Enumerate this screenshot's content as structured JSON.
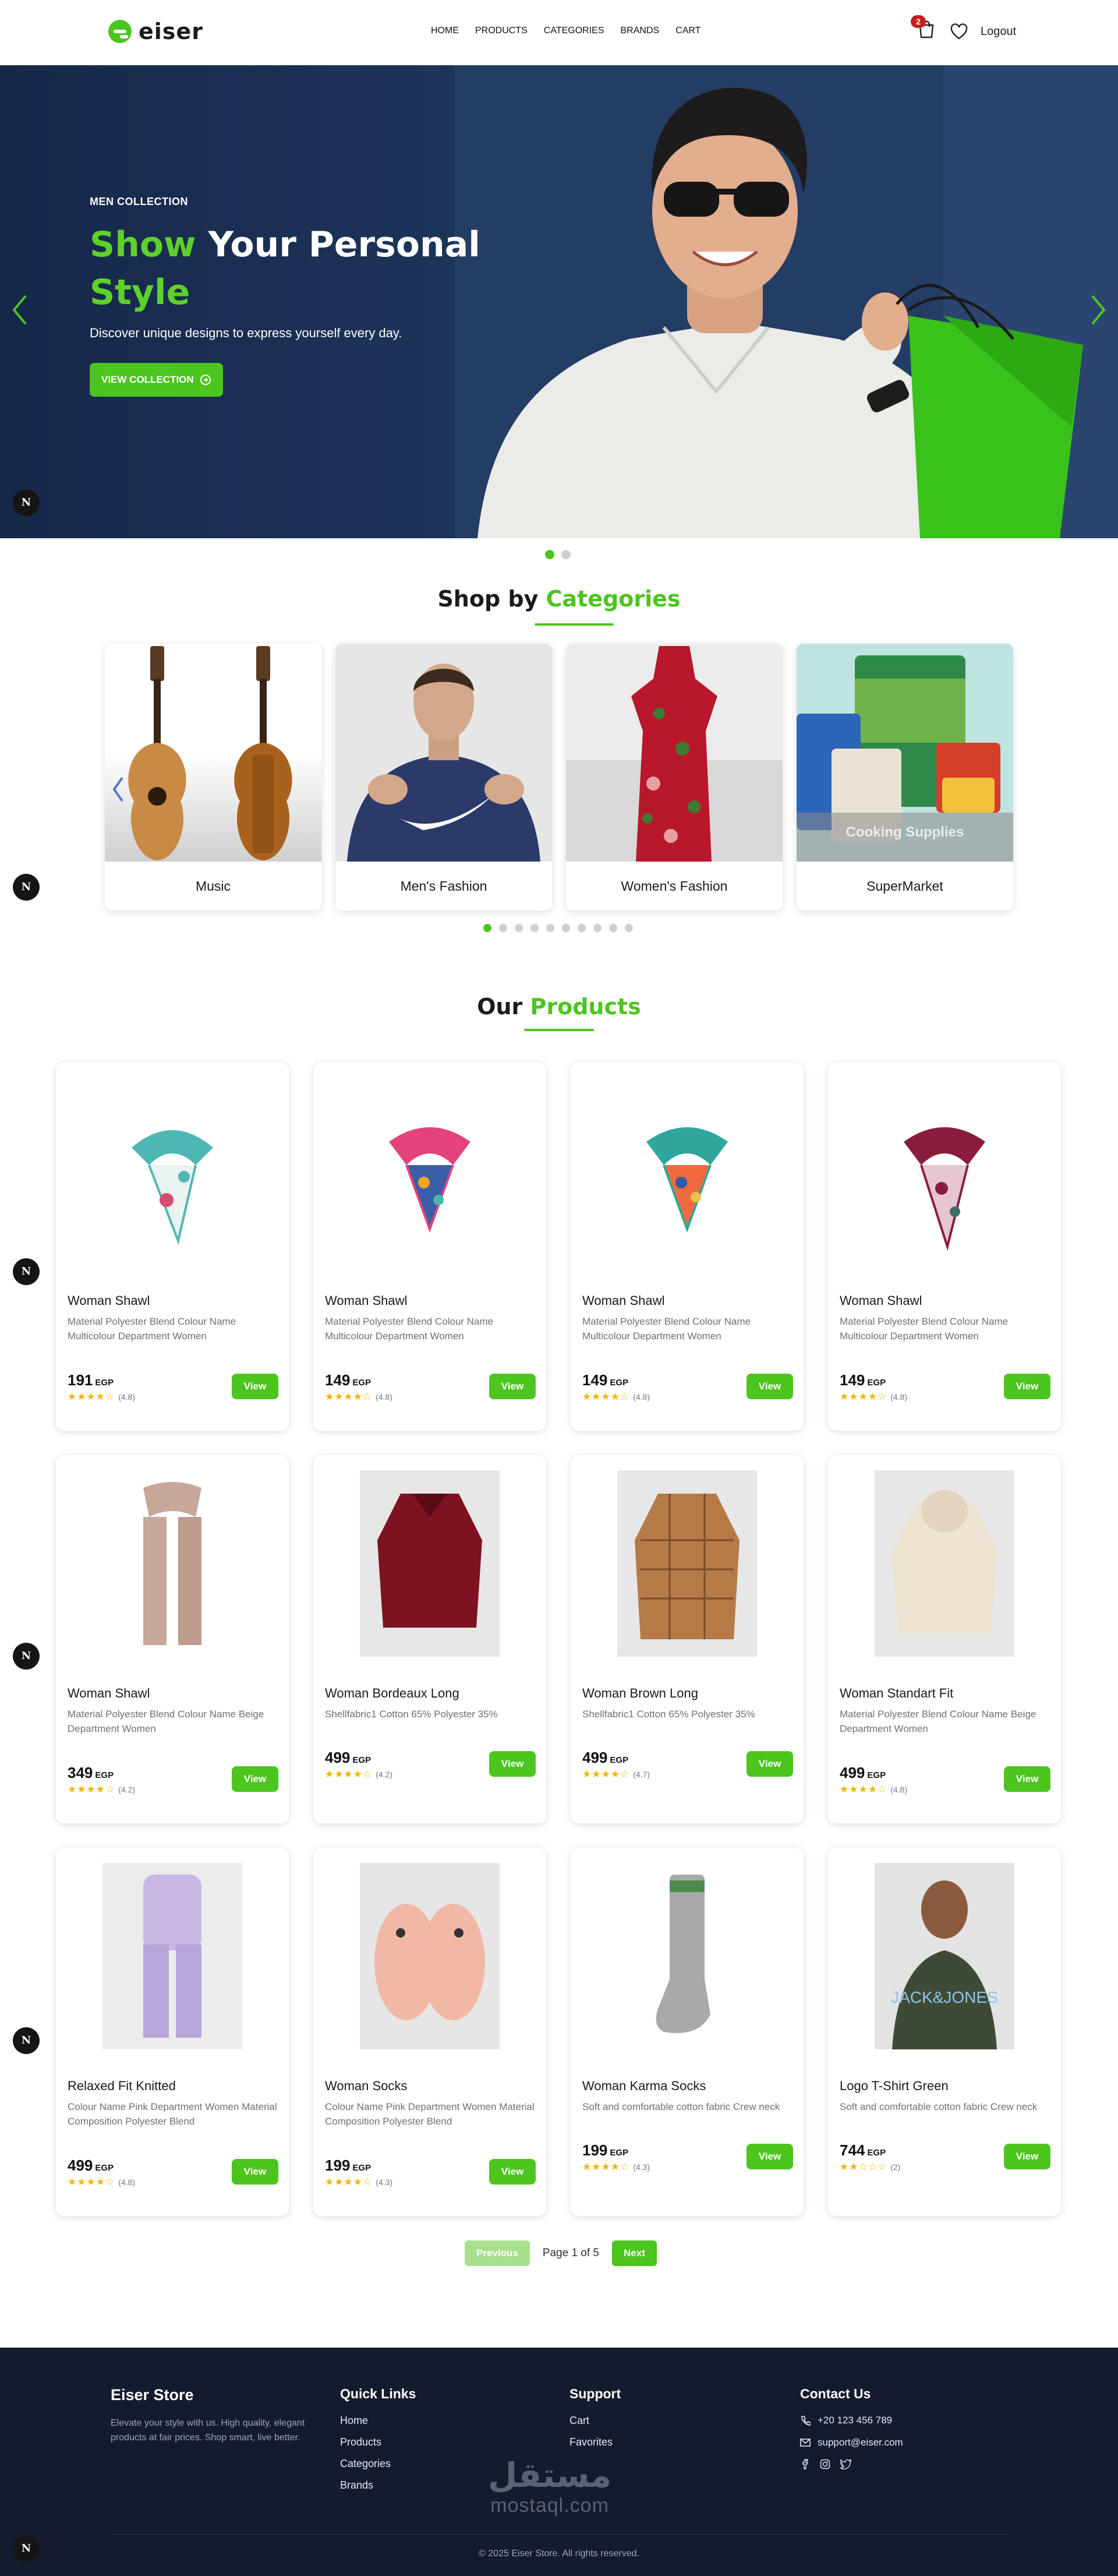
{
  "brand": {
    "name": "eiser",
    "accent": "#4cc51f"
  },
  "nav": {
    "links": [
      "HOME",
      "PRODUCTS",
      "CATEGORIES",
      "BRANDS",
      "CART"
    ],
    "cart_count": "2",
    "logout": "Logout"
  },
  "hero": {
    "eyebrow": "MEN COLLECTION",
    "title_green": "Show",
    "title_white": " Your Personal",
    "title_line2": "Style",
    "subtitle": "Discover unique designs to express yourself every day.",
    "button": "VIEW COLLECTION",
    "active_slide": 1,
    "slide_count": 2
  },
  "categories": {
    "title_dark": "Shop by ",
    "title_green": "Categories",
    "items": [
      {
        "name": "Music"
      },
      {
        "name": "Men's Fashion"
      },
      {
        "name": "Women's Fashion"
      },
      {
        "name": "SuperMarket",
        "overlay": "Cooking Supplies"
      }
    ],
    "page_dots": 10,
    "active_dot": 1
  },
  "products": {
    "title_dark": "Our ",
    "title_green": "Products",
    "currency": "EGP",
    "view_label": "View",
    "items": [
      {
        "name": "Woman Shawl",
        "desc": "Material Polyester Blend Colour Name Multicolour Department Women",
        "price": "191",
        "stars": 4,
        "rating": "(4.8)"
      },
      {
        "name": "Woman Shawl",
        "desc": "Material Polyester Blend Colour Name Multicolour Department Women",
        "price": "149",
        "stars": 4,
        "rating": "(4.8)"
      },
      {
        "name": "Woman Shawl",
        "desc": "Material Polyester Blend Colour Name Multicolour Department Women",
        "price": "149",
        "stars": 4,
        "rating": "(4.8)"
      },
      {
        "name": "Woman Shawl",
        "desc": "Material Polyester Blend Colour Name Multicolour Department Women",
        "price": "149",
        "stars": 4,
        "rating": "(4.8)"
      },
      {
        "name": "Woman Shawl",
        "desc": "Material Polyester Blend Colour Name Beige Department Women",
        "price": "349",
        "stars": 4,
        "rating": "(4.2)"
      },
      {
        "name": "Woman Bordeaux Long",
        "desc": "Shellfabric1 Cotton 65% Polyester 35%",
        "price": "499",
        "stars": 4,
        "rating": "(4.2)"
      },
      {
        "name": "Woman Brown Long",
        "desc": "Shellfabric1 Cotton 65% Polyester 35%",
        "price": "499",
        "stars": 4,
        "rating": "(4.7)"
      },
      {
        "name": "Woman Standart Fit",
        "desc": "Material Polyester Blend Colour Name Beige Department Women",
        "price": "499",
        "stars": 4,
        "rating": "(4.8)"
      },
      {
        "name": "Relaxed Fit Knitted",
        "desc": "Colour Name Pink Department Women Material Composition Polyester Blend",
        "price": "499",
        "stars": 4,
        "rating": "(4.8)"
      },
      {
        "name": "Woman Socks",
        "desc": "Colour Name Pink Department Women Material Composition Polyester Blend",
        "price": "199",
        "stars": 4,
        "rating": "(4.3)"
      },
      {
        "name": "Woman Karma Socks",
        "desc": "Soft and comfortable cotton fabric Crew neck",
        "price": "199",
        "stars": 4,
        "rating": "(4.3)"
      },
      {
        "name": "Logo T-Shirt Green",
        "desc": "Soft and comfortable cotton fabric Crew neck",
        "price": "744",
        "stars": 2,
        "rating": "(2)"
      }
    ]
  },
  "pagination": {
    "prev": "Previous",
    "info": "Page 1 of 5",
    "next": "Next",
    "current": 1,
    "total": 5
  },
  "footer": {
    "brand": "Eiser Store",
    "about": "Elevate your style with us. High quality, elegant products at fair prices. Shop smart, live better.",
    "quick_links_title": "Quick Links",
    "quick_links": [
      "Home",
      "Products",
      "Categories",
      "Brands"
    ],
    "support_title": "Support",
    "support_links": [
      "Cart",
      "Favorites"
    ],
    "contact_title": "Contact Us",
    "phone": "+20 123 456 789",
    "email": "support@eiser.com",
    "copyright": "© 2025 Eiser Store. All rights reserved.",
    "watermark_ar": "مستقل",
    "watermark_en": "mostaql.com"
  }
}
